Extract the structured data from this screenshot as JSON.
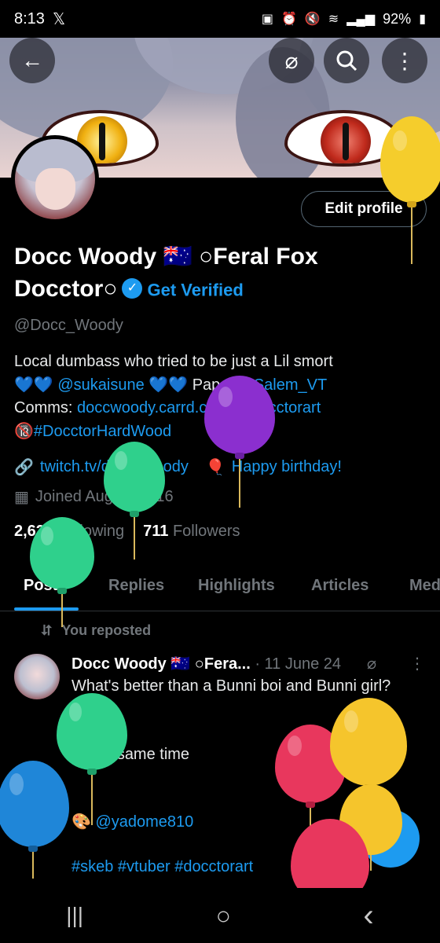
{
  "status_bar": {
    "time": "8:13",
    "x_glyph": "𝕏",
    "battery": "92%",
    "icons": [
      "dnd-icon",
      "alarm-icon",
      "mute-icon",
      "wifi-icon",
      "signal-icon",
      "battery-icon"
    ]
  },
  "top_buttons": {
    "back": "back-arrow-icon",
    "grok": "slash-circle-icon",
    "search": "search-icon",
    "more": "more-vertical-icon"
  },
  "profile": {
    "edit_label": "Edit profile",
    "display_name_line1": "Docc Woody 🇦🇺 ○Feral Fox",
    "display_name_line2": "Docctor○",
    "get_verified": "Get Verified",
    "handle": "@Docc_Woody",
    "bio_line1": "Local dumbass who tried to be just a Lil smort",
    "bio_hearts1": "💙💙",
    "bio_mention1": "@sukaisune",
    "bio_hearts2": "💙💙",
    "bio_papa": "Papa:",
    "bio_mention2": "@Salem_VT",
    "bio_comms": "Comms:",
    "bio_comms_link": "doccwoody.carrd.co",
    "bio_palette": "🎨",
    "bio_tag1": "#Docctorart",
    "bio_18": "🔞",
    "bio_tag2": "#DocctorHardWood",
    "website": "twitch.tv/docc_woody",
    "birthday": "Happy birthday!",
    "joined": "Joined August 2016",
    "following_count": "2,625",
    "following_label": "Following",
    "followers_count": "711",
    "followers_label": "Followers"
  },
  "tabs": [
    "Posts",
    "Replies",
    "Highlights",
    "Articles",
    "Media"
  ],
  "post": {
    "repost_label": "You reposted",
    "author": "Docc Woody 🇦🇺 ○Fera...",
    "time": "· 11 June 24",
    "body": "What's better than a Bunni boi and Bunni girl?\n\nBoth~\n At the same time\n\n",
    "credit_icon": "🎨",
    "credit_mention": "@yadome810",
    "tags": "#skeb #vtuber #docctorart"
  },
  "fab_label": "+",
  "navbar": {
    "recent": "|||",
    "home": "○",
    "back": "‹"
  },
  "colors": {
    "accent": "#1d9bf0",
    "bg": "#000000",
    "muted": "#71767b"
  }
}
